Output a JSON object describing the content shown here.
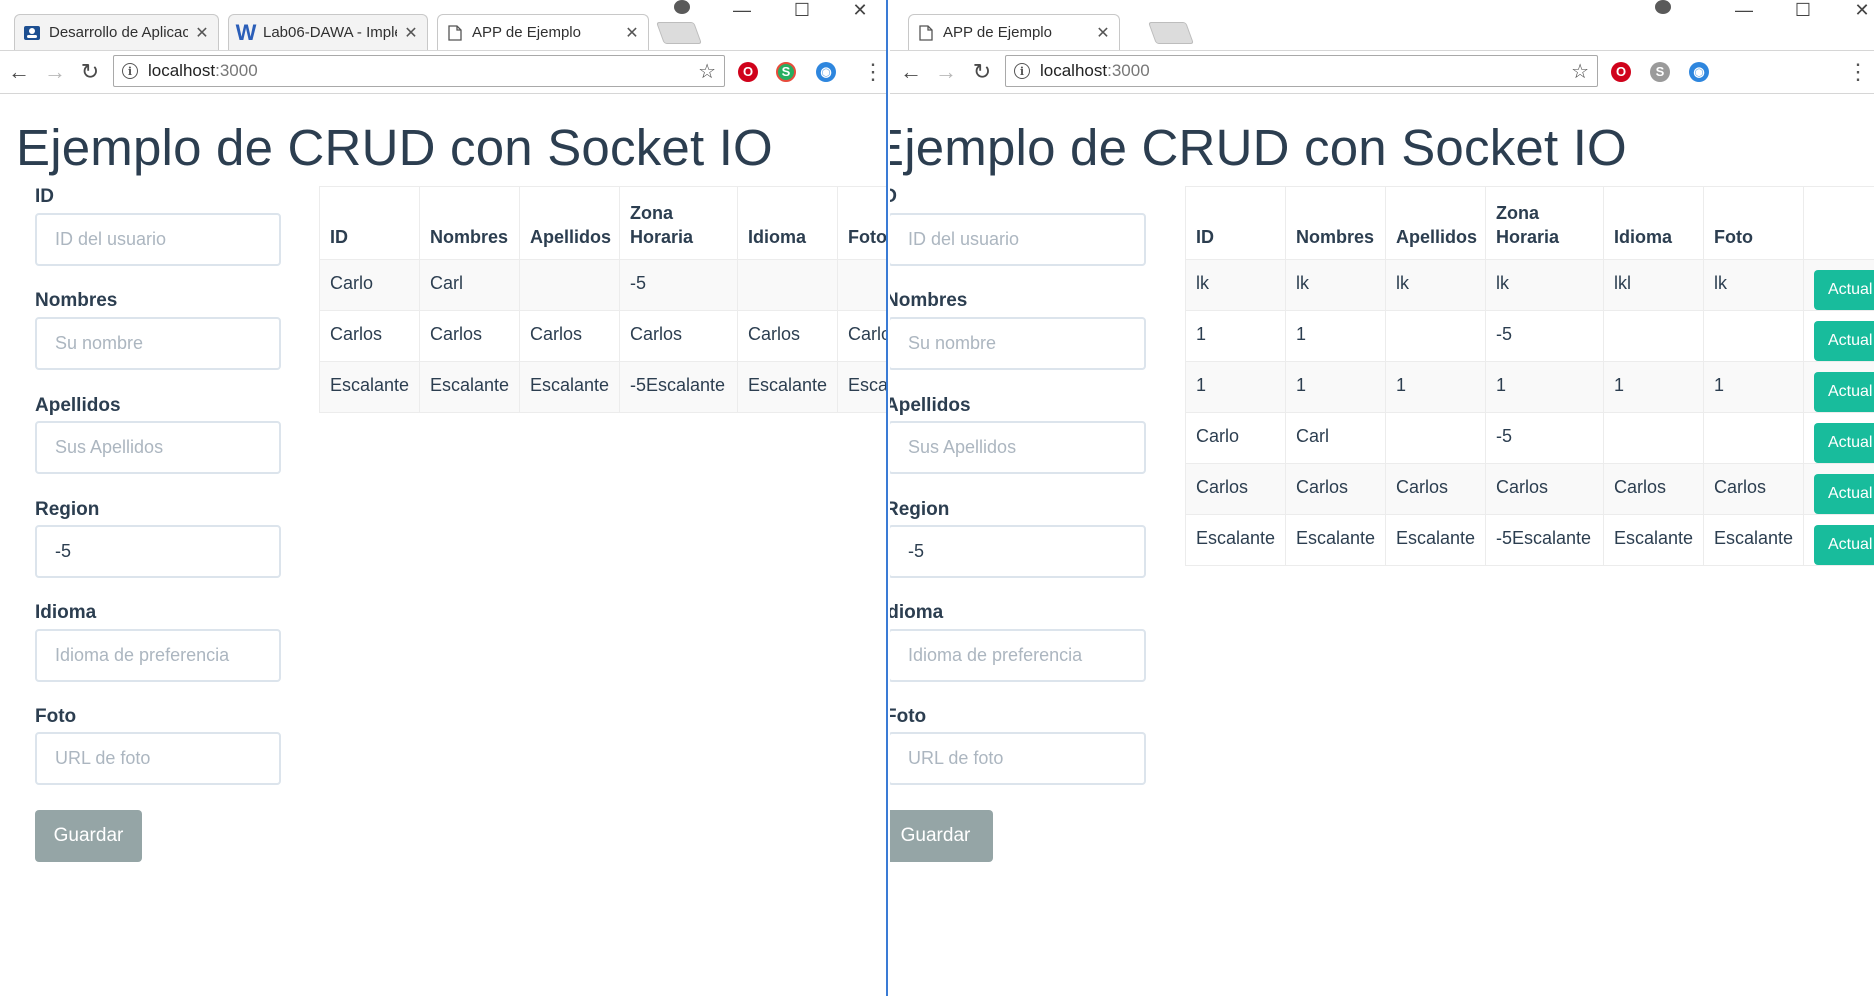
{
  "left": {
    "tabs": [
      {
        "title": "Desarrollo de Aplicac",
        "icon": "person-card-icon",
        "active": false
      },
      {
        "title": "Lab06-DAWA - Imple",
        "icon": "word-doc-icon",
        "active": false
      },
      {
        "title": "APP de Ejemplo",
        "icon": "page-icon",
        "active": true
      }
    ],
    "address": {
      "host": "localhost",
      "port": ":3000"
    },
    "page_title": "Ejemplo de CRUD con Socket IO",
    "form": {
      "id_label": "ID",
      "id_placeholder": "ID del usuario",
      "id_value": "",
      "nombres_label": "Nombres",
      "nombres_placeholder": "Su nombre",
      "nombres_value": "",
      "apellidos_label": "Apellidos",
      "apellidos_placeholder": "Sus Apellidos",
      "apellidos_value": "",
      "region_label": "Region",
      "region_placeholder": "",
      "region_value": "-5",
      "idioma_label": "Idioma",
      "idioma_placeholder": "Idioma de preferencia",
      "idioma_value": "",
      "foto_label": "Foto",
      "foto_placeholder": "URL de foto",
      "foto_value": "",
      "save_label": "Guardar"
    },
    "table": {
      "headers": [
        "ID",
        "Nombres",
        "Apellidos",
        "Zona Horaria",
        "Idioma",
        "Foto"
      ],
      "rows": [
        [
          "Carlo",
          "Carl",
          "",
          "-5",
          "",
          ""
        ],
        [
          "Carlos",
          "Carlos",
          "Carlos",
          "Carlos",
          "Carlos",
          "Carlos"
        ],
        [
          "Escalante",
          "Escalante",
          "Escalante",
          "-5Escalante",
          "Escalante",
          "Escalante"
        ]
      ]
    }
  },
  "right": {
    "tabs": [
      {
        "title": "APP de Ejemplo",
        "icon": "page-icon",
        "active": true
      }
    ],
    "address": {
      "host": "localhost",
      "port": ":3000"
    },
    "page_title": "Ejemplo de CRUD con Socket IO",
    "form": {
      "id_label": "ID",
      "id_placeholder": "ID del usuario",
      "id_value": "",
      "nombres_label": "Nombres",
      "nombres_placeholder": "Su nombre",
      "nombres_value": "",
      "apellidos_label": "Apellidos",
      "apellidos_placeholder": "Sus Apellidos",
      "apellidos_value": "",
      "region_label": "Region",
      "region_placeholder": "",
      "region_value": "-5",
      "idioma_label": "Idioma",
      "idioma_placeholder": "Idioma de preferencia",
      "idioma_value": "",
      "foto_label": "Foto",
      "foto_placeholder": "URL de foto",
      "foto_value": "",
      "save_label": "Guardar"
    },
    "table": {
      "headers": [
        "ID",
        "Nombres",
        "Apellidos",
        "Zona Horaria",
        "Idioma",
        "Foto",
        ""
      ],
      "action_label": "Actual",
      "rows": [
        [
          "lk",
          "lk",
          "lk",
          "lk",
          "lkl",
          "lk"
        ],
        [
          "1",
          "1",
          "",
          "-5",
          "",
          ""
        ],
        [
          "1",
          "1",
          "1",
          "1",
          "1",
          "1"
        ],
        [
          "Carlo",
          "Carl",
          "",
          "-5",
          "",
          ""
        ],
        [
          "Carlos",
          "Carlos",
          "Carlos",
          "Carlos",
          "Carlos",
          "Carlos"
        ],
        [
          "Escalante",
          "Escalante",
          "Escalante",
          "-5Escalante",
          "Escalante",
          "Escalante"
        ]
      ]
    }
  },
  "colors": {
    "text": "#2c3e50",
    "save_button": "#95a5a6",
    "update_button": "#18bc9c",
    "input_border": "#dce4ec",
    "placeholder": "#acb6c0",
    "divider": "#3a7bd5"
  },
  "icons": {
    "back": "back-arrow-icon",
    "forward": "forward-arrow-icon",
    "reload": "reload-icon",
    "info": "info-icon",
    "bookmark": "star-icon",
    "opera": "opera-icon",
    "skype": "skype-icon",
    "globe": "globe-icon",
    "menu": "menu-dots-icon"
  }
}
